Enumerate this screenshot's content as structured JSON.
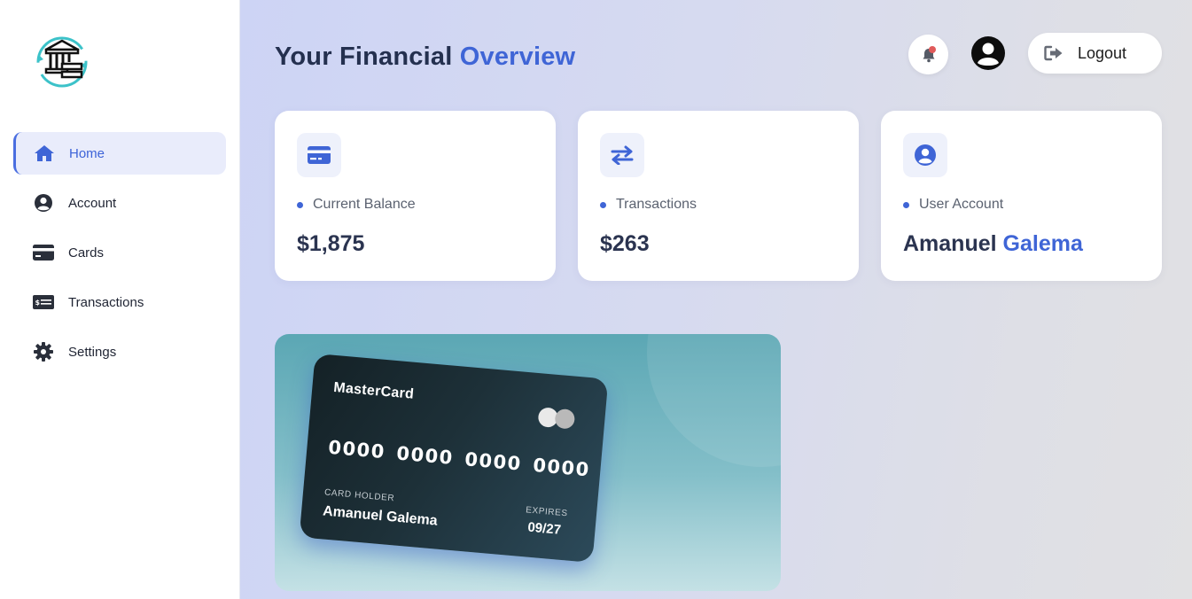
{
  "sidebar": {
    "items": [
      {
        "label": "Home",
        "icon": "home-icon"
      },
      {
        "label": "Account",
        "icon": "user-circle-icon"
      },
      {
        "label": "Cards",
        "icon": "credit-card-icon"
      },
      {
        "label": "Transactions",
        "icon": "money-bill-icon"
      },
      {
        "label": "Settings",
        "icon": "gear-icon"
      }
    ],
    "active": "Home"
  },
  "header": {
    "title_prefix": "Your Financial",
    "title_accent": "Overview",
    "logout_label": "Logout"
  },
  "stats": [
    {
      "label": "Current Balance",
      "value": "$1,875",
      "icon": "credit-card-icon"
    },
    {
      "label": "Transactions",
      "value": "$263",
      "icon": "exchange-arrows-icon"
    },
    {
      "label": "User Account",
      "value_first": "Amanuel",
      "value_accent": "Galema",
      "icon": "user-circle-icon"
    }
  ],
  "card": {
    "brand": "MasterCard",
    "number": "0000 0000 0000 0000",
    "holder_label": "CARD HOLDER",
    "holder_name": "Amanuel Galema",
    "expires_label": "EXPIRES",
    "expires_value": "09/27"
  },
  "colors": {
    "accent": "#3f65d6",
    "dark_text": "#24304f",
    "notification_dot": "#e05a5a"
  }
}
